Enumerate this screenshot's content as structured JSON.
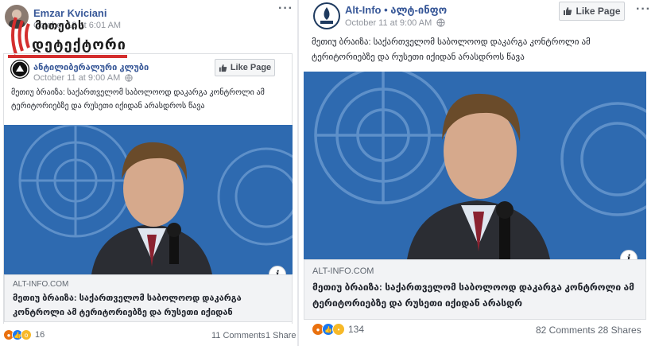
{
  "left_post": {
    "sharer_name": "Emzar Kviciani",
    "sharer_time": "October 12 at 6:01 AM",
    "watermark": {
      "line1": "მითების",
      "line2": "დეტექტორი",
      "accent_color": "#d42e2e"
    },
    "inner": {
      "page_name": "ანტილიბერალური კლუბი",
      "time": "October 11 at 9:00 AM",
      "like_page_label": "Like Page",
      "text": "მეთიუ ბრაიზა: საქართველომ საბოლოოდ დაკარგა კონტროლი ამ ტერიტორიებზე და რუსეთი იქიდან არასდროს წავა"
    },
    "link_site": "ALT-INFO.COM",
    "link_title": "მეთიუ ბრაიზა: საქართველომ საბოლოოდ დაკარგა კონტროლი ამ ტერიტორიებზე და რუსეთი იქიდან",
    "reactions_count": "16",
    "comments": "11 Comments",
    "shares": "1 Share"
  },
  "right_post": {
    "page_name": "Alt-Info",
    "page_name_suffix": "• ალტ-ინფო",
    "time": "October 11 at 9:00 AM",
    "like_page_label": "Like Page",
    "text": "მეთიუ ბრაიზა: საქართველომ საბოლოოდ დაკარგა კონტროლი ამ ტერიტორიებზე და რუსეთი იქიდან არასდროს წავა",
    "link_site": "ALT-INFO.COM",
    "link_title": "მეთიუ ბრაიზა: საქართველომ საბოლოოდ დაკარგა კონტროლი ამ ტერიტორიებზე და რუსეთი იქიდან არასდრ",
    "reactions_count": "134",
    "comments": "82 Comments",
    "shares": "28 Shares"
  },
  "colors": {
    "facebook_link": "#385898",
    "un_blue": "#2f6fb5",
    "angry": "#e9710f",
    "like": "#1877f2",
    "wow": "#f7b928"
  },
  "icons": [
    "more-options-icon",
    "globe-icon",
    "like-thumb-icon",
    "info-icon",
    "angry-reaction-icon",
    "like-reaction-icon",
    "wow-reaction-icon",
    "sad-reaction-icon"
  ]
}
